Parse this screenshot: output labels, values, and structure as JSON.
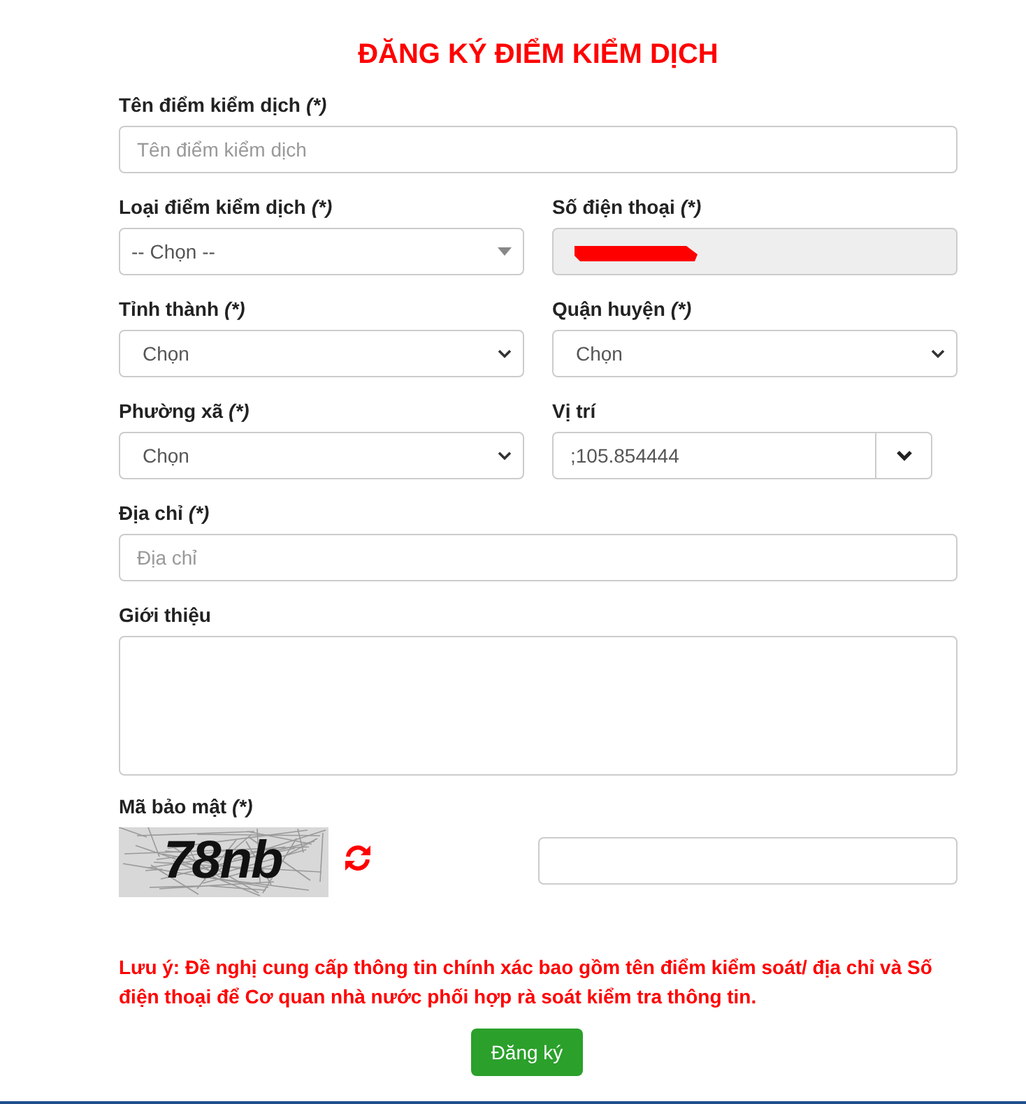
{
  "title": "ĐĂNG KÝ ĐIỂM KIỂM DỊCH",
  "rows": [
    [
      {
        "kind": "text",
        "label": "Tên điểm kiểm dịch",
        "mark": "(*)",
        "placeholder": "Tên điểm kiểm dịch"
      }
    ],
    [
      {
        "kind": "combo",
        "label": "Loại điểm kiểm dịch",
        "mark": "(*)",
        "value": "-- Chọn --"
      },
      {
        "kind": "readonly",
        "label": "Số điện thoại",
        "mark": "(*)",
        "redacted": true
      }
    ],
    [
      {
        "kind": "select",
        "label": "Tỉnh thành",
        "mark": "(*)",
        "value": "Chọn"
      },
      {
        "kind": "select",
        "label": "Quận huyện",
        "mark": "(*)",
        "value": "Chọn"
      }
    ],
    [
      {
        "kind": "select",
        "label": "Phường xã",
        "mark": "(*)",
        "value": "Chọn"
      },
      {
        "kind": "location",
        "label": "Vị trí",
        "value": ";105.854444"
      }
    ],
    [
      {
        "kind": "text",
        "label": "Địa chỉ",
        "mark": "(*)",
        "placeholder": "Địa chỉ"
      }
    ],
    [
      {
        "kind": "textarea",
        "label": "Giới thiệu"
      }
    ]
  ],
  "captcha": {
    "label": "Mã bảo mật",
    "mark": "(*)",
    "code": "78nb"
  },
  "note": "Lưu ý: Đề nghị cung cấp thông tin chính xác bao gồm tên điểm kiểm soát/ địa chỉ và Số điện thoại để Cơ quan nhà nước phối hợp rà soát kiểm tra thông tin.",
  "submit": "Đăng ký"
}
